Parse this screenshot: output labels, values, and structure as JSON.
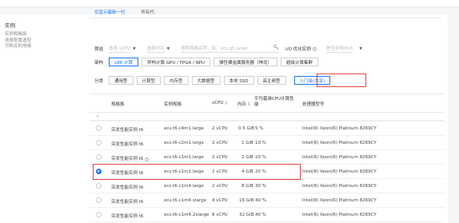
{
  "left_nav": {
    "title": "实例",
    "links": [
      "实例规格族",
      "场景配置选型",
      "可购买的地域"
    ]
  },
  "tabs": [
    {
      "label": "仅显示最新一代",
      "active": true
    },
    {
      "label": "所有代",
      "active": false
    }
  ],
  "filter": {
    "label": "筛选",
    "vcpu_placeholder": "选择 vCPU",
    "mem_placeholder": "选择内存",
    "search_placeholder": "搜索规格名称，如：ecs.g5.large",
    "io_label": "I/O 优化实例",
    "ipv6_placeholder": "是否支持IPv6"
  },
  "arch": {
    "label": "架构",
    "options": [
      {
        "label": "x86 计算",
        "selected": true
      },
      {
        "label": "异构计算 GPU / FPGA / NPU",
        "selected": false
      },
      {
        "label": "弹性裸金属服务器（神龙）",
        "selected": false
      },
      {
        "label": "超级计算集群",
        "selected": false
      }
    ]
  },
  "category": {
    "label": "分类",
    "options": [
      {
        "label": "通用型",
        "selected": false
      },
      {
        "label": "计算型",
        "selected": false
      },
      {
        "label": "内存型",
        "selected": false
      },
      {
        "label": "大数据型",
        "selected": false
      },
      {
        "label": "本地 SSD",
        "selected": false
      },
      {
        "label": "高主频型",
        "selected": false
      },
      {
        "label": "入门级(共享)",
        "selected": true
      }
    ]
  },
  "table": {
    "headers": [
      "规格族",
      "实例规格",
      "vCPU",
      "内存",
      "平均基准CPU计算性能",
      "处理器型号"
    ],
    "left_indicator": "<",
    "rows": [
      {
        "family": "突发性能实例 t6",
        "spec": "ecs.t6-c4m1.large",
        "vcpu": "2 vCPU",
        "mem": "0.5 GiB",
        "perf": "5 %",
        "cpu": "Intel(R) Xeon(R) Platinum 8269CY",
        "selected": false,
        "help": false
      },
      {
        "family": "突发性能实例 t6",
        "spec": "ecs.t6-c2m1.large",
        "vcpu": "2 vCPU",
        "mem": "1 GiB",
        "perf": "10 %",
        "cpu": "Intel(R) Xeon(R) Platinum 8269CY",
        "selected": false,
        "help": false
      },
      {
        "family": "突发性能实例 t6",
        "spec": "ecs.t6-c1m1.large",
        "vcpu": "2 vCPU",
        "mem": "2 GiB",
        "perf": "20 %",
        "cpu": "Intel(R) Xeon(R) Platinum 8269CY",
        "selected": false,
        "help": true
      },
      {
        "family": "突发性能实例 t6",
        "spec": "ecs.t6-c1m2.large",
        "vcpu": "2 vCPU",
        "mem": "4 GiB",
        "perf": "20 %",
        "cpu": "Intel(R) Xeon(R) Platinum 8269CY",
        "selected": true,
        "help": false
      },
      {
        "family": "突发性能实例 t6",
        "spec": "ecs.t6-c1m4.large",
        "vcpu": "2 vCPU",
        "mem": "8 GiB",
        "perf": "30 %",
        "cpu": "Intel(R) Xeon(R) Platinum 8269CY",
        "selected": false,
        "help": false
      },
      {
        "family": "突发性能实例 t6",
        "spec": "ecs.t6-c1m4.xlarge",
        "vcpu": "4 vCPU",
        "mem": "16 GiB",
        "perf": "40 %",
        "cpu": "Intel(R) Xeon(R) Platinum 8269CY",
        "selected": false,
        "help": false
      },
      {
        "family": "突发性能实例 t6",
        "spec": "ecs.t6-c1m4.2xlarge",
        "vcpu": "8 vCPU",
        "mem": "32 GiB",
        "perf": "40 %",
        "cpu": "Intel(R) Xeon(R) Platinum 8269CY",
        "selected": false,
        "help": false
      }
    ]
  },
  "colors": {
    "accent": "#1677ff",
    "highlight": "#e54545"
  }
}
